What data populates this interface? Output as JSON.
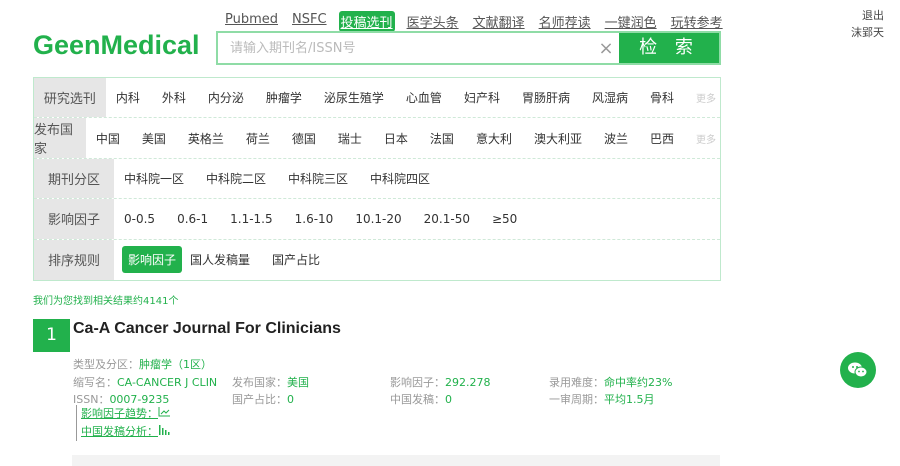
{
  "nav": [
    "Pubmed",
    "NSFC",
    "投稿选刊",
    "医学头条",
    "文献翻译",
    "名师荐读",
    "一键润色",
    "玩转参考"
  ],
  "nav_active": 2,
  "user": {
    "logout": "退出",
    "name": "沫郢天"
  },
  "logo": "GeenMedical",
  "search": {
    "placeholder": "请输入期刊名/ISSN号",
    "clear": "×",
    "button": "检 索"
  },
  "filters": [
    {
      "label": "研究选刊",
      "items": [
        "内科",
        "外科",
        "内分泌",
        "肿瘤学",
        "泌尿生殖学",
        "心血管",
        "妇产科",
        "胃肠肝病",
        "风湿病",
        "骨科"
      ],
      "more": "更多"
    },
    {
      "label": "发布国家",
      "items": [
        "中国",
        "美国",
        "英格兰",
        "荷兰",
        "德国",
        "瑞士",
        "日本",
        "法国",
        "意大利",
        "澳大利亚",
        "波兰",
        "巴西"
      ],
      "more": "更多"
    },
    {
      "label": "期刊分区",
      "items": [
        "中科院一区",
        "中科院二区",
        "中科院三区",
        "中科院四区"
      ]
    },
    {
      "label": "影响因子",
      "items": [
        "0-0.5",
        "0.6-1",
        "1.1-1.5",
        "1.6-10",
        "10.1-20",
        "20.1-50",
        "≥50"
      ]
    },
    {
      "label": "排序规则",
      "items": [
        "影响因子",
        "国人发稿量",
        "国产占比"
      ],
      "selected": 0
    }
  ],
  "result_count": "我们为您找到相关结果约4141个",
  "result": {
    "index": "1",
    "title": "Ca-A Cancer Journal For Clinicians",
    "type_label": "类型及分区：",
    "type_value": "肿瘤学（1区）",
    "abbr_label": "缩写名：",
    "abbr_value": "CA-CANCER J CLIN",
    "country_label": "发布国家：",
    "country_value": "美国",
    "if_label": "影响因子：",
    "if_value": "292.278",
    "diff_label": "录用难度：",
    "diff_value": "命中率约23%",
    "issn_label": "ISSN：",
    "issn_value": "0007-9235",
    "domestic_label": "国产占比：",
    "domestic_value": "0",
    "cn_label": "中国发稿：",
    "cn_value": "0",
    "review_label": "一审周期：",
    "review_value": "平均1.5月",
    "trend_link": "影响因子趋势：",
    "cn_analysis_link": "中国发稿分析："
  }
}
